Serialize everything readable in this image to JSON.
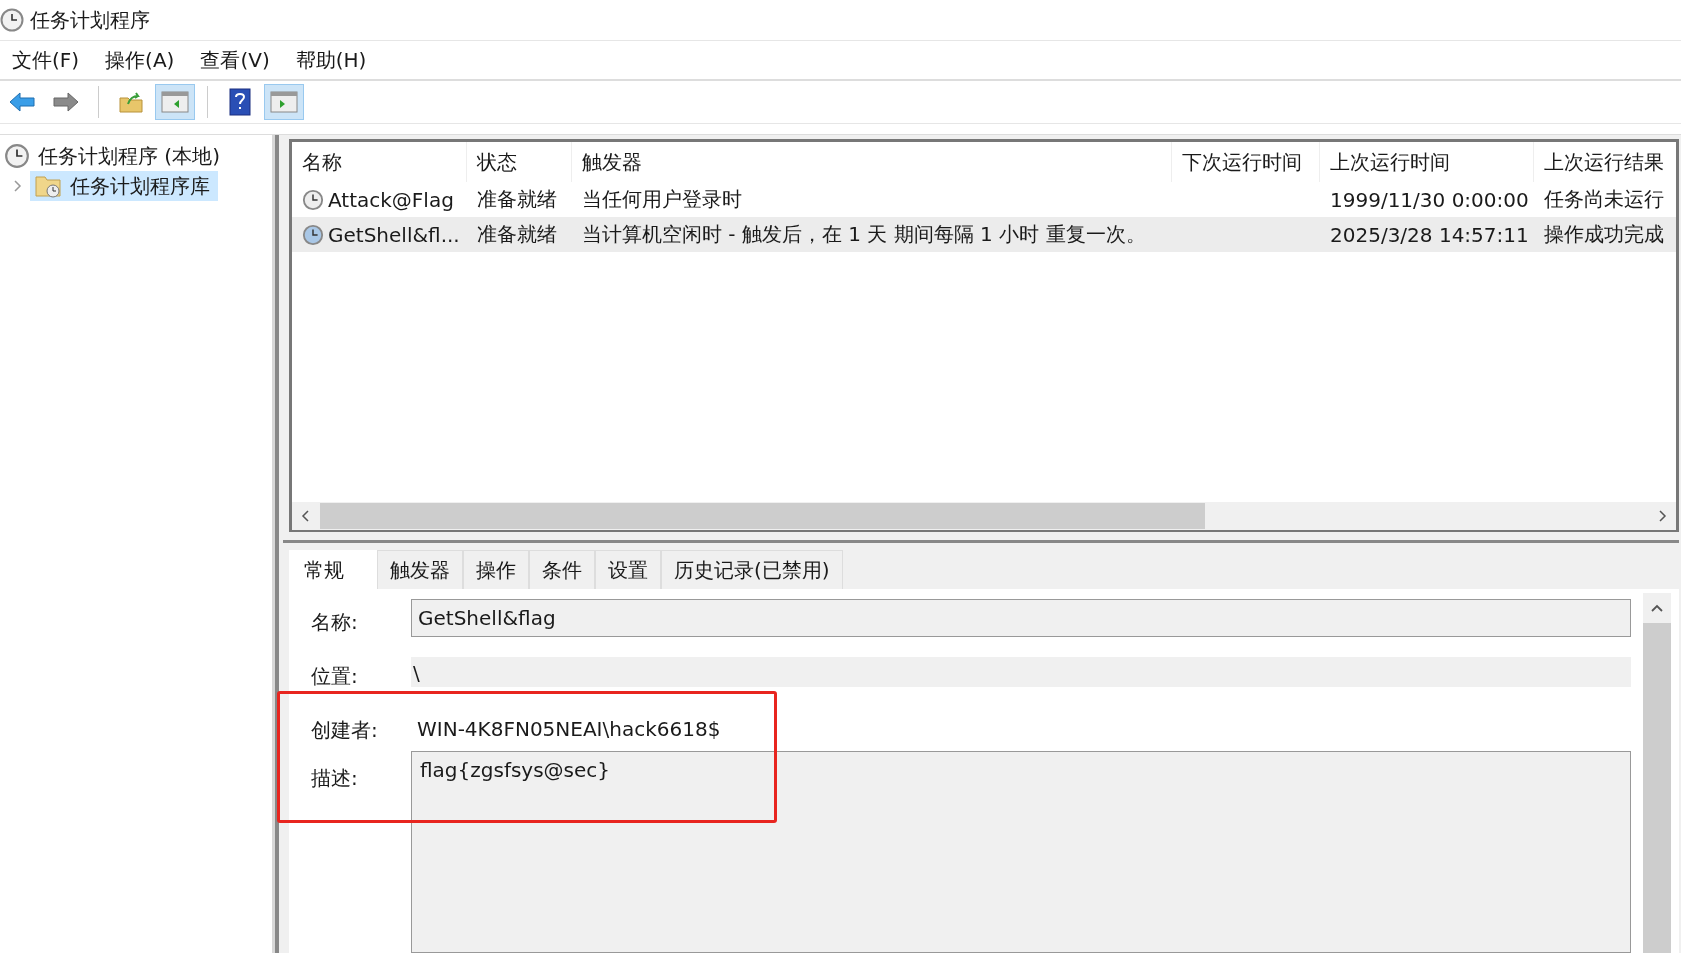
{
  "window": {
    "title": "任务计划程序"
  },
  "menu": [
    {
      "label": "文件(F)"
    },
    {
      "label": "操作(A)"
    },
    {
      "label": "查看(V)"
    },
    {
      "label": "帮助(H)"
    }
  ],
  "toolbar": [
    {
      "kind": "back",
      "pressed": false
    },
    {
      "kind": "forward",
      "pressed": false
    },
    {
      "kind": "sep"
    },
    {
      "kind": "up-folder",
      "pressed": false
    },
    {
      "kind": "show-tree",
      "pressed": true
    },
    {
      "kind": "sep"
    },
    {
      "kind": "help",
      "pressed": false
    },
    {
      "kind": "show-actions",
      "pressed": true
    }
  ],
  "tree": [
    {
      "label": "任务计划程序 (本地)",
      "selected": false,
      "children": [
        {
          "label": "任务计划程序库",
          "selected": true,
          "expanded": false
        }
      ]
    }
  ],
  "table": {
    "columns": [
      "名称",
      "状态",
      "触发器",
      "下次运行时间",
      "上次运行时间",
      "上次运行结果"
    ],
    "rows": [
      {
        "selected": false,
        "cells": [
          "Attack@Flag",
          "准备就绪",
          "当任何用户登录时",
          "",
          "1999/11/30 0:00:00",
          "任务尚未运行"
        ]
      },
      {
        "selected": true,
        "cells": [
          "GetShell&fl...",
          "准备就绪",
          "当计算机空闲时 - 触发后，在 1 天 期间每隔 1 小时 重复一次。",
          "",
          "2025/3/28 14:57:11",
          "操作成功完成"
        ]
      }
    ]
  },
  "details": {
    "tabs": [
      {
        "label": "常规",
        "selected": true
      },
      {
        "label": "触发器",
        "selected": false
      },
      {
        "label": "操作",
        "selected": false
      },
      {
        "label": "条件",
        "selected": false
      },
      {
        "label": "设置",
        "selected": false
      },
      {
        "label": "历史记录(已禁用)",
        "selected": false
      }
    ],
    "fields": [
      {
        "kind": "input",
        "label": "名称:",
        "value": "GetShell&flag"
      },
      {
        "kind": "readonly",
        "label": "位置:",
        "value": "\\"
      },
      {
        "kind": "text",
        "label": "创建者:",
        "value": "WIN-4K8FN05NEAI\\hack6618$"
      },
      {
        "kind": "textarea",
        "label": "描述:",
        "value": "flag{zgsfsys@sec}"
      }
    ]
  }
}
